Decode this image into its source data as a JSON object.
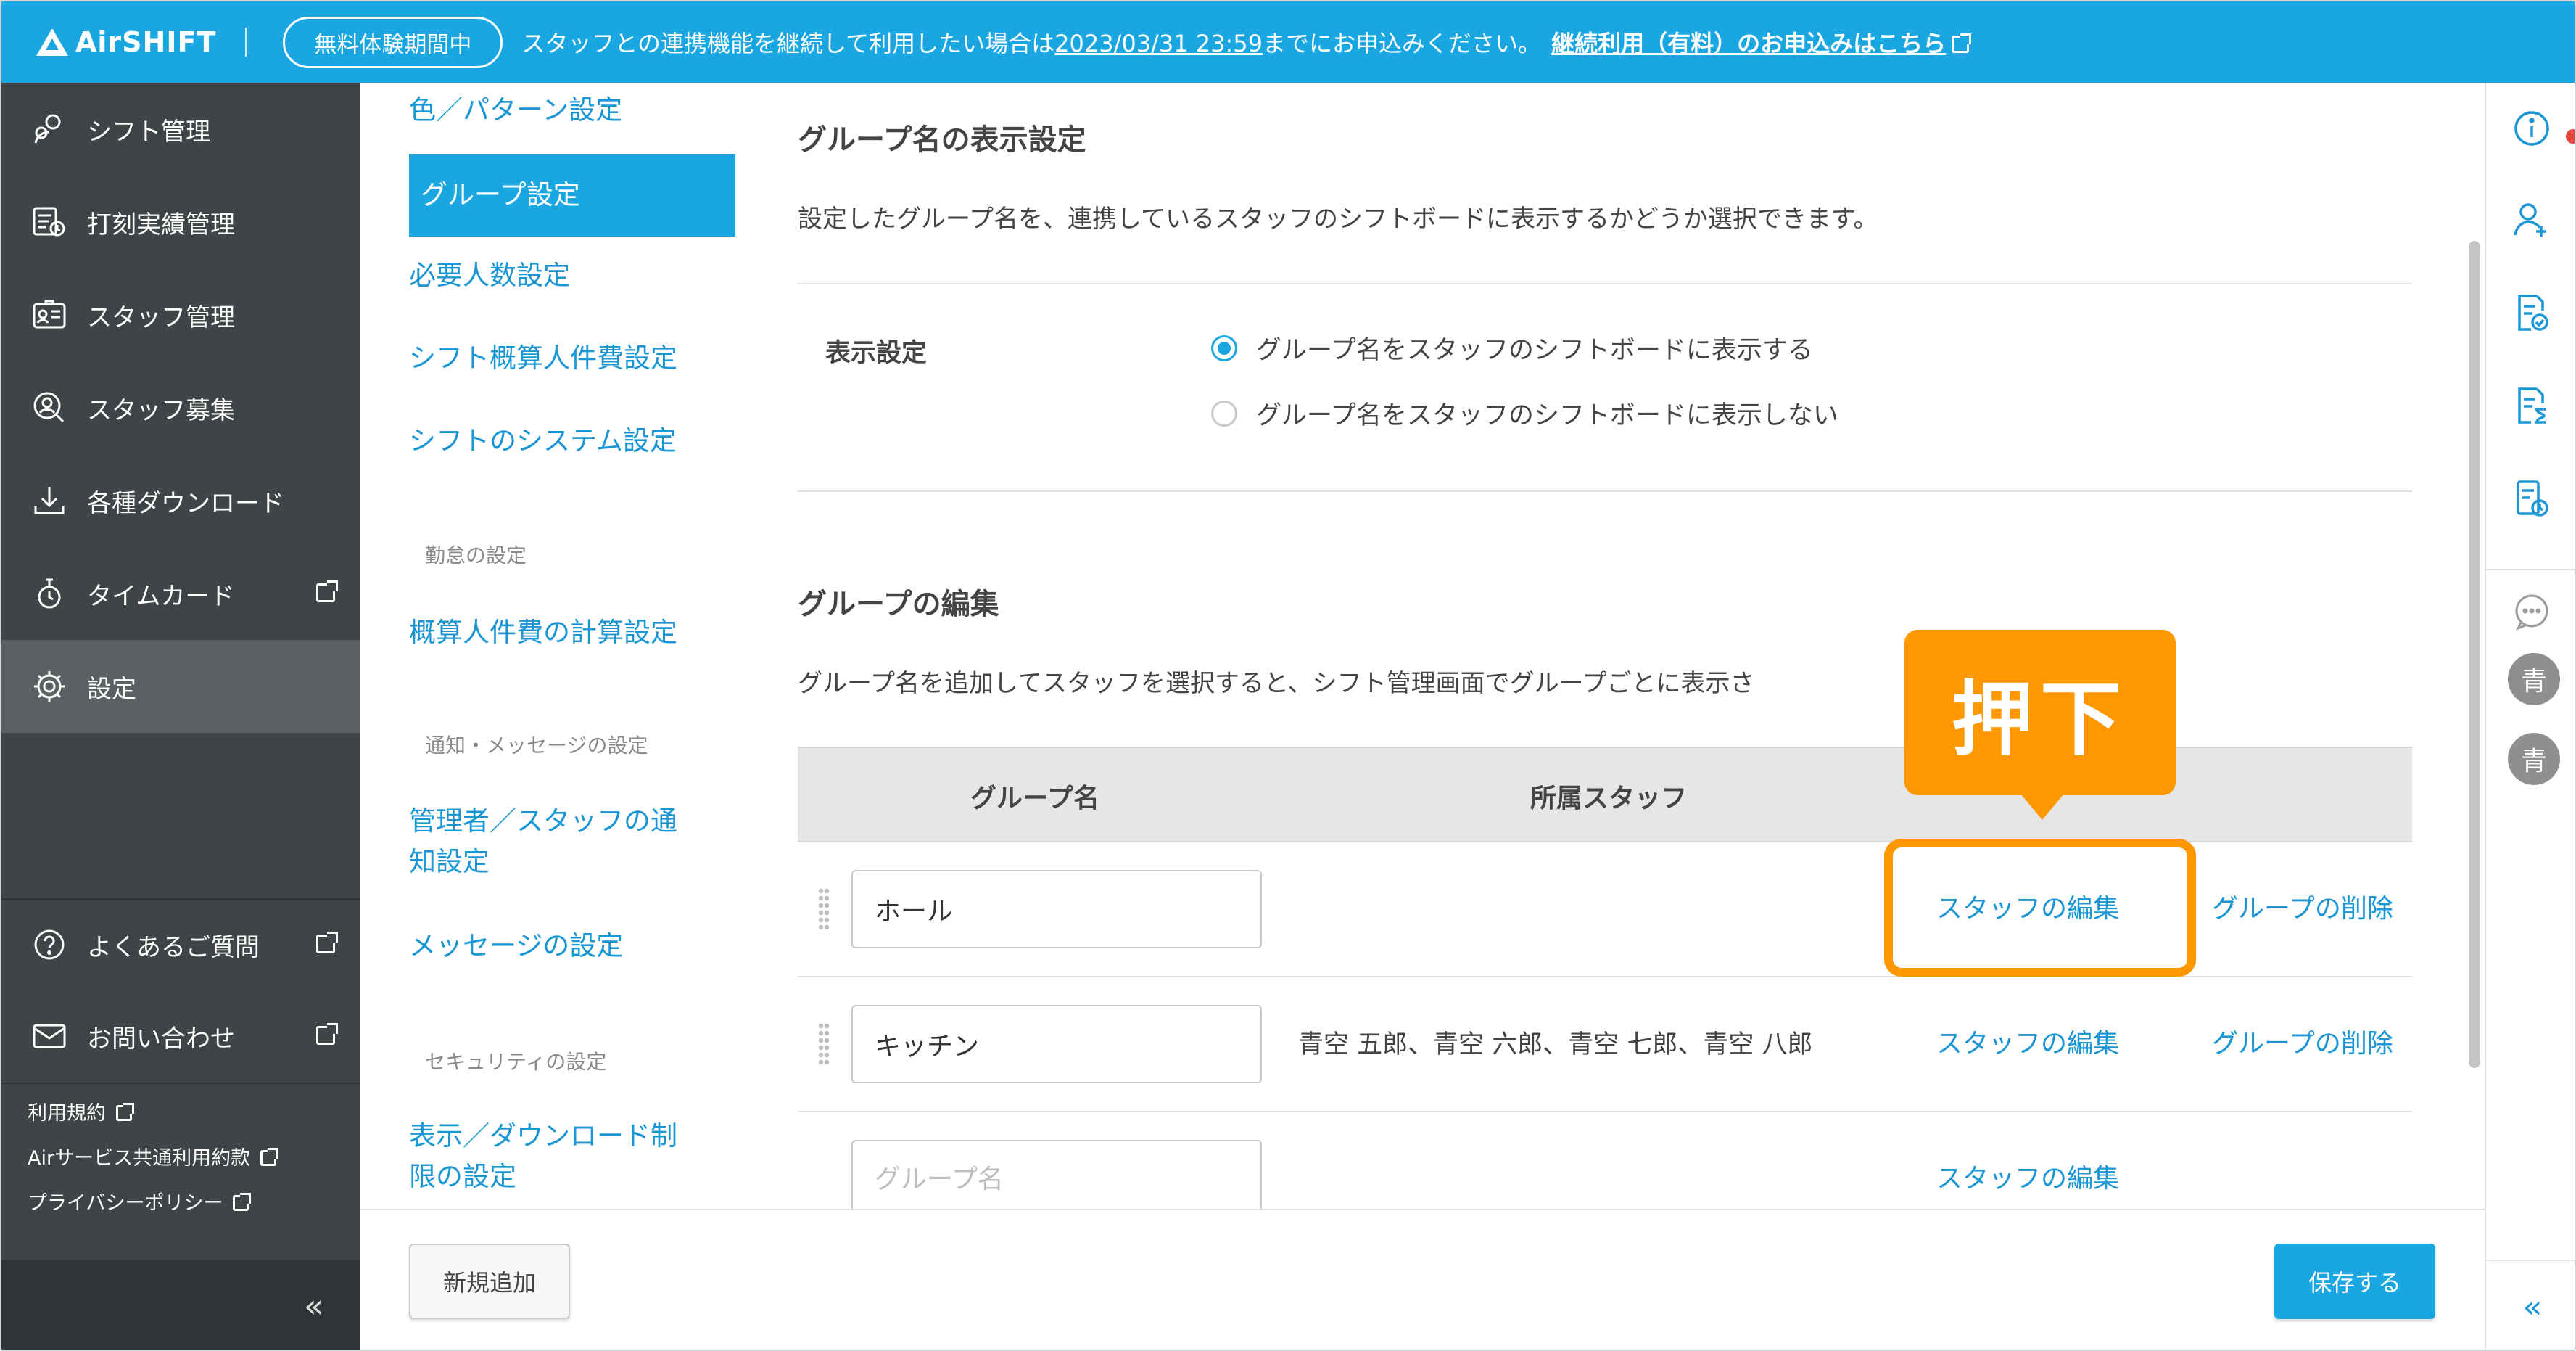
{
  "header": {
    "logo": "AirSHIFT",
    "trial_badge": "無料体験期間中",
    "notice_prefix": "スタッフとの連携機能を継続して利用したい場合は",
    "notice_deadline": "2023/03/31 23:59",
    "notice_suffix": "までにお申込みください。",
    "notice_link": "継続利用（有料）のお申込みはこちら"
  },
  "sidebar": {
    "items": [
      {
        "label": "シフト管理",
        "icon": "calendar-person-icon"
      },
      {
        "label": "打刻実績管理",
        "icon": "clock-list-icon"
      },
      {
        "label": "スタッフ管理",
        "icon": "id-card-icon"
      },
      {
        "label": "スタッフ募集",
        "icon": "person-search-icon"
      },
      {
        "label": "各種ダウンロード",
        "icon": "download-icon"
      },
      {
        "label": "タイムカード",
        "icon": "timecard-icon"
      },
      {
        "label": "設定",
        "icon": "gear-icon"
      }
    ],
    "bottom": [
      {
        "label": "よくあるご質問",
        "icon": "question-icon"
      },
      {
        "label": "お問い合わせ",
        "icon": "mail-icon"
      }
    ],
    "legal": [
      "利用規約",
      "Airサービス共通利用約款",
      "プライバシーポリシー"
    ],
    "collapse": "«"
  },
  "subnav": {
    "items": [
      "色／パターン設定",
      "グループ設定",
      "必要人数設定",
      "シフト概算人件費設定",
      "シフトのシステム設定"
    ],
    "section_attendance": "勤怠の設定",
    "attendance_items": [
      "概算人件費の計算設定"
    ],
    "section_notify": "通知・メッセージの設定",
    "notify_items": [
      "管理者／スタッフの通",
      "知設定",
      "メッセージの設定"
    ],
    "section_security": "セキュリティの設定",
    "security_items": [
      "表示／ダウンロード制",
      "限の設定"
    ]
  },
  "main": {
    "display_title": "グループ名の表示設定",
    "display_desc": "設定したグループ名を、連携しているスタッフのシフトボードに表示するかどうか選択できます。",
    "display_label": "表示設定",
    "radio_show": "グループ名をスタッフのシフトボードに表示する",
    "radio_hide": "グループ名をスタッフのシフトボードに表示しない",
    "edit_title": "グループの編集",
    "edit_desc": "グループ名を追加してスタッフを選択すると、シフト管理画面でグループごとに表示さ",
    "table": {
      "col_name": "グループ名",
      "col_staff": "所属スタッフ",
      "rows": [
        {
          "name": "ホール",
          "staff": "",
          "edit": "スタッフの編集",
          "delete": "グループの削除"
        },
        {
          "name": "キッチン",
          "staff": "青空 五郎、青空 六郎、青空 七郎、青空 八郎",
          "edit": "スタッフの編集",
          "delete": "グループの削除"
        },
        {
          "name": "",
          "placeholder": "グループ名",
          "staff": "",
          "edit": "スタッフの編集"
        }
      ]
    }
  },
  "callout": "押下",
  "footer": {
    "new_button": "新規追加",
    "save_button": "保存する"
  },
  "rail": {
    "avatars": [
      "青",
      "青"
    ],
    "collapse": "«"
  },
  "colors": {
    "brand": "#1aa7e1",
    "sidebar": "#3f4446",
    "callout": "#ff9800",
    "link": "#1a96d4"
  }
}
